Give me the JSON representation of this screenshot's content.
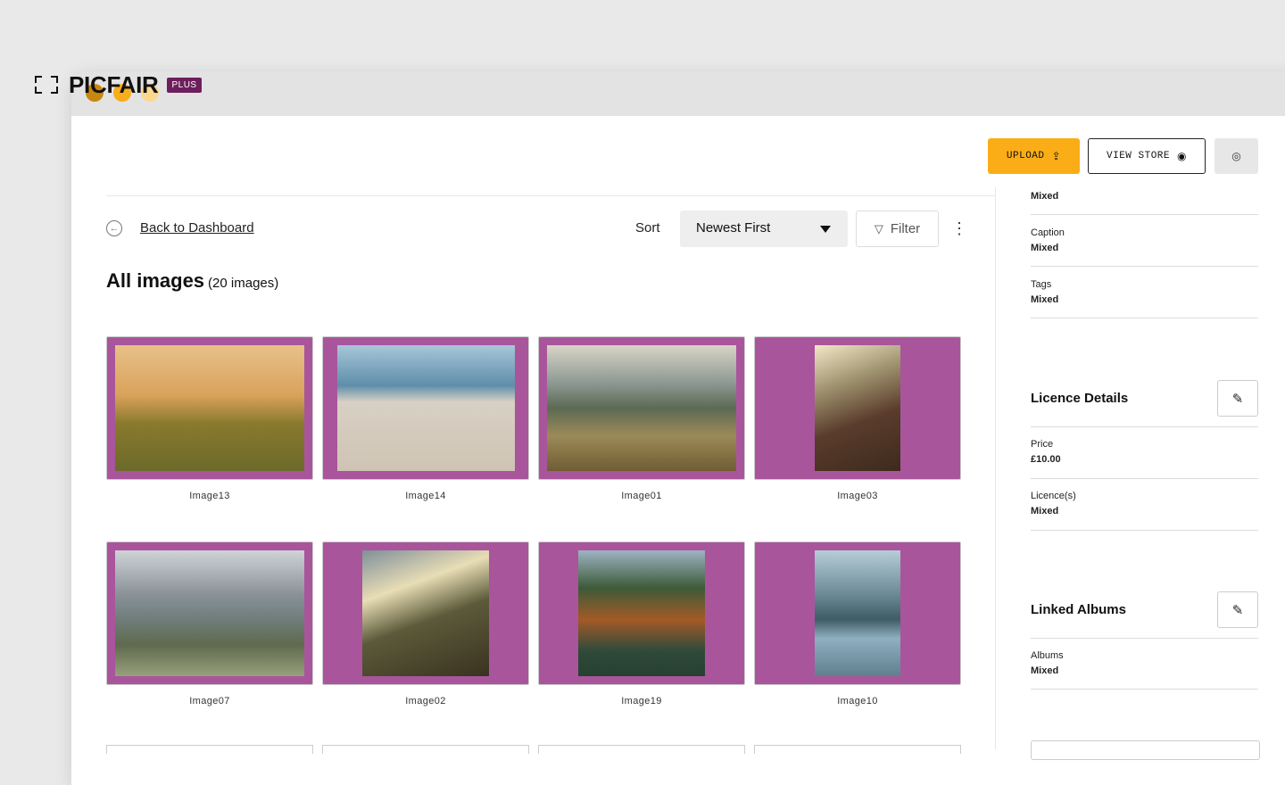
{
  "app": {
    "logo_text": "PICFAIR",
    "logo_badge": "PLUS"
  },
  "header": {
    "upload_label": "UPLOAD",
    "view_store_label": "VIEW STORE"
  },
  "toolbar": {
    "back_label": "Back to Dashboard",
    "sort_label": "Sort",
    "sort_value": "Newest First",
    "filter_label": "Filter"
  },
  "page": {
    "title": "All images",
    "count": "(20 images)"
  },
  "images": [
    {
      "name": "Image13",
      "grad": "linear-gradient(180deg,#e7c18a 0%,#d9a25a 40%,#8a7a2e 62%,#6b6a2a 100%)",
      "orient": "landscape"
    },
    {
      "name": "Image14",
      "grad": "linear-gradient(180deg,#a8c6d9 0%,#5e8eaa 32%,#d8d0c4 45%,#cfc4b4 100%)",
      "orient": "landscape-narrow"
    },
    {
      "name": "Image01",
      "grad": "linear-gradient(180deg,#d9d4c6 0%,#8d9993 30%,#5c6a54 50%,#9c8a58 72%,#6f5d34 100%)",
      "orient": "landscape"
    },
    {
      "name": "Image03",
      "grad": "linear-gradient(160deg,#f3e7c8 0%,#a09470 30%,#5a3c2c 60%,#3d2a1c 100%)",
      "orient": "portrait"
    },
    {
      "name": "Image07",
      "grad": "linear-gradient(180deg,#cfd3d6 0%,#8a9298 35%,#6e7d7a 55%,#5f6a4e 75%,#98a07c 100%)",
      "orient": "landscape"
    },
    {
      "name": "Image02",
      "grad": "linear-gradient(160deg,#7f8f99 0%,#e8ddb5 30%,#5c5a3a 55%,#3a3220 100%)",
      "orient": "portrait-wide"
    },
    {
      "name": "Image19",
      "grad": "linear-gradient(180deg,#9eb3c2 0%,#3d5a38 30%,#a35a26 55%,#2f4a3a 80%,#274030 100%)",
      "orient": "portrait-wide"
    },
    {
      "name": "Image10",
      "grad": "linear-gradient(180deg,#b7cdd8 0%,#6b8a95 35%,#3f5c64 55%,#8fb0c0 70%,#5f7f8f 100%)",
      "orient": "portrait"
    }
  ],
  "sidebar": {
    "partial_value": "Mixed",
    "caption_label": "Caption",
    "caption_value": "Mixed",
    "tags_label": "Tags",
    "tags_value": "Mixed",
    "licence_heading": "Licence Details",
    "price_label": "Price",
    "price_value": "£10.00",
    "licences_label": "Licence(s)",
    "licences_value": "Mixed",
    "albums_heading": "Linked Albums",
    "albums_label": "Albums",
    "albums_value": "Mixed"
  },
  "colors": {
    "accent": "#fbad17",
    "badge": "#6d1f5c",
    "tile_bg": "#a9559c"
  }
}
